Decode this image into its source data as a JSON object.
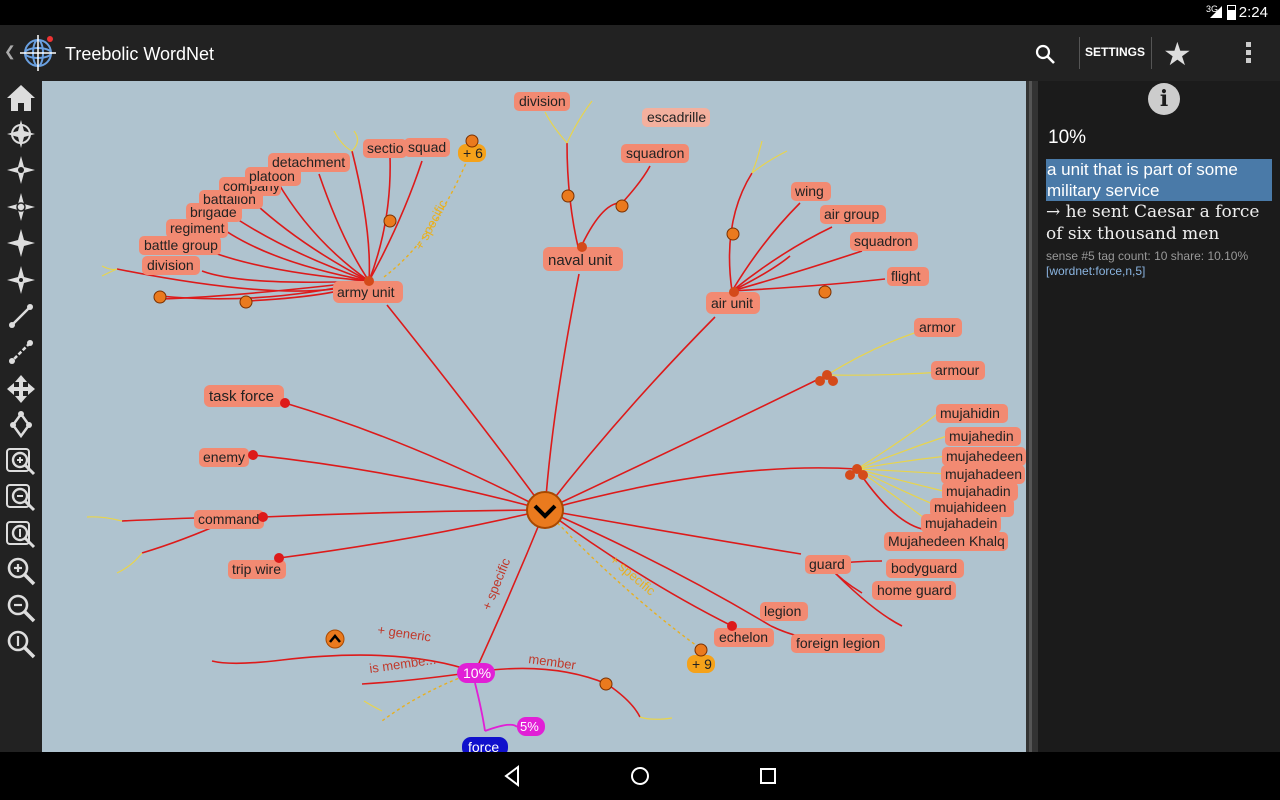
{
  "status": {
    "network": "3G",
    "time": "2:24"
  },
  "app": {
    "title": "Treebolic WordNet",
    "settings_label": "SETTINGS",
    "icons": {
      "search": "search-icon",
      "favorite": "star-icon",
      "overflow": "more-vert-icon",
      "logo": "treebolic-logo"
    }
  },
  "toolbar": {
    "tools": [
      "home-icon",
      "focus-icon",
      "focus-parent-icon",
      "mode-icon-1",
      "mode-icon-2",
      "mode-icon-3",
      "edge-style-icon-1",
      "edge-style-icon-2",
      "expand-icon",
      "shrink-icon",
      "zoom-in-frame-icon",
      "zoom-out-frame-icon",
      "zoom-reset-frame-icon",
      "zoom-in-icon",
      "zoom-out-icon",
      "zoom-one-icon"
    ]
  },
  "tree": {
    "root_percent": "10%",
    "focus_node": "force",
    "focus_percent": "5%",
    "edge_labels": {
      "specific_down": "+ specific",
      "specific_right": "+ specific",
      "specific_army": "+ specific",
      "generic": "+ generic",
      "is_member": "is membe...",
      "member": "member"
    },
    "army": [
      "army unit",
      "division",
      "battle group",
      "regiment",
      "brigade",
      "battalion",
      "company",
      "platoon",
      "detachment",
      "sectio",
      "squad"
    ],
    "army_more": "+ 6",
    "naval": [
      "naval unit",
      "division",
      "escadrille",
      "squadron"
    ],
    "air": [
      "air unit",
      "wing",
      "air group",
      "squadron",
      "flight"
    ],
    "armor": [
      "armor",
      "armour"
    ],
    "mujahid": [
      "mujahidin",
      "mujahedin",
      "mujahedeen",
      "mujahadeen",
      "mujahadin",
      "mujahideen",
      "mujahadein",
      "Mujahedeen Khalq"
    ],
    "guard": [
      "guard",
      "bodyguard",
      "home guard"
    ],
    "legion": [
      "legion",
      "foreign legion"
    ],
    "left": [
      "task force",
      "enemy",
      "command",
      "trip wire",
      "echelon"
    ],
    "right_more": "+ 9"
  },
  "info": {
    "percent": "10%",
    "definition": "a unit that is part of some military service",
    "example": "→ he sent Caesar a force of six thousand men",
    "meta": "sense #5 tag count: 10 share: 10.10%",
    "link": "[wordnet:force,n,5]",
    "icon": "info-icon"
  },
  "nav": {
    "back": "back-icon",
    "home": "home-circle-icon",
    "recents": "recents-icon"
  }
}
